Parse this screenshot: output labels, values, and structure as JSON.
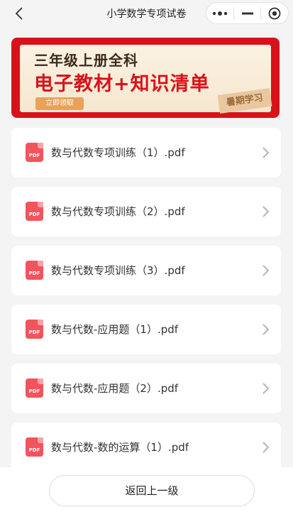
{
  "navbar": {
    "title": "小学数学专项试卷",
    "back_icon": "chevron-left-icon",
    "capsule": {
      "more_icon": "more-dots-icon",
      "minimize_icon": "minimize-icon",
      "close_icon": "target-close-icon"
    }
  },
  "banner": {
    "line1": "三年级上册全科",
    "line2": "电子教材+知识清单",
    "button_label": "立即领取",
    "stamp_text": "暑期学习",
    "colors": {
      "frame": "#d7121a",
      "accent_text": "#d8121a"
    }
  },
  "files": [
    {
      "name": "数与代数专项训练（1）.pdf",
      "icon": "pdf-icon",
      "icon_text": "PDF"
    },
    {
      "name": "数与代数专项训练（2）.pdf",
      "icon": "pdf-icon",
      "icon_text": "PDF"
    },
    {
      "name": "数与代数专项训练（3）.pdf",
      "icon": "pdf-icon",
      "icon_text": "PDF"
    },
    {
      "name": "数与代数-应用题（1）.pdf",
      "icon": "pdf-icon",
      "icon_text": "PDF"
    },
    {
      "name": "数与代数-应用题（2）.pdf",
      "icon": "pdf-icon",
      "icon_text": "PDF"
    },
    {
      "name": "数与代数-数的运算（1）.pdf",
      "icon": "pdf-icon",
      "icon_text": "PDF"
    }
  ],
  "footer": {
    "back_label": "返回上一级"
  }
}
